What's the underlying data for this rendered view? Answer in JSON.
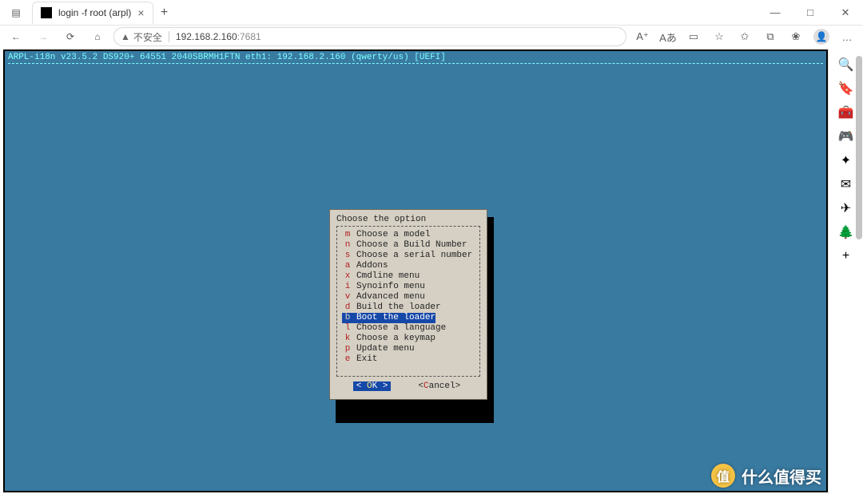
{
  "window": {
    "tab_title": "login -f root (arpl)",
    "new_tab_glyph": "+",
    "minimize_glyph": "—",
    "maximize_glyph": "□",
    "close_glyph": "✕"
  },
  "address": {
    "back_glyph": "←",
    "forward_glyph": "→",
    "refresh_glyph": "⟳",
    "home_glyph": "⌂",
    "warn_glyph": "▲",
    "insecure_label": "不安全",
    "url_host": "192.168.2.160",
    "url_port": ":7681",
    "aa_label": "Aあ",
    "more_glyph": "…"
  },
  "terminal": {
    "header": "ARPL-i18n v23.5.2 DS920+ 64551 2040SBRMH1FTN eth1: 192.168.2.160 (qwerty/us) [UEFI]"
  },
  "dialog": {
    "title": "Choose the option",
    "menu": [
      {
        "key": "m",
        "label": "Choose a model",
        "selected": false
      },
      {
        "key": "n",
        "label": "Choose a Build Number",
        "selected": false
      },
      {
        "key": "s",
        "label": "Choose a serial number",
        "selected": false
      },
      {
        "key": "a",
        "label": "Addons",
        "selected": false
      },
      {
        "key": "x",
        "label": "Cmdline menu",
        "selected": false
      },
      {
        "key": "i",
        "label": "Synoinfo menu",
        "selected": false
      },
      {
        "key": "v",
        "label": "Advanced menu",
        "selected": false
      },
      {
        "key": "d",
        "label": "Build the loader",
        "selected": false
      },
      {
        "key": "b",
        "label": "Boot the loader",
        "selected": true
      },
      {
        "key": "l",
        "label": "Choose a language",
        "selected": false
      },
      {
        "key": "k",
        "label": "Choose a keymap",
        "selected": false
      },
      {
        "key": "p",
        "label": "Update menu",
        "selected": false
      },
      {
        "key": "e",
        "label": "Exit",
        "selected": false
      }
    ],
    "ok_pre": "<  ",
    "ok_hot": "O",
    "ok_rest": "K  >",
    "cancel_pre": "<",
    "cancel_hot": "C",
    "cancel_rest": "ancel>"
  },
  "rail": {
    "items": [
      {
        "name": "search-icon",
        "glyph": "🔍"
      },
      {
        "name": "tag-icon",
        "glyph": "🔖"
      },
      {
        "name": "shopping-icon",
        "glyph": "🧰"
      },
      {
        "name": "people-icon",
        "glyph": "🎮"
      },
      {
        "name": "copilot-icon",
        "glyph": "✦"
      },
      {
        "name": "outlook-icon",
        "glyph": "✉"
      },
      {
        "name": "send-icon",
        "glyph": "✈"
      },
      {
        "name": "tree-icon",
        "glyph": "🌲"
      },
      {
        "name": "add-icon",
        "glyph": "+"
      }
    ]
  },
  "watermark": {
    "badge": "值",
    "text": "什么值得买"
  }
}
